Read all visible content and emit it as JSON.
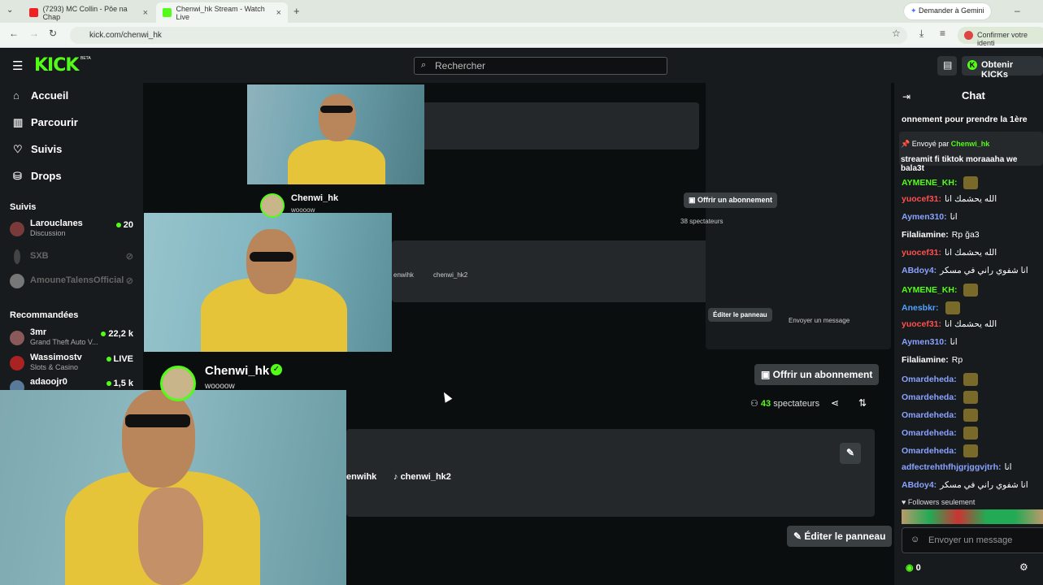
{
  "browser": {
    "tabs": [
      {
        "label": "(7293) MC Collin - Pôe na Chap"
      },
      {
        "label": "Chenwi_hk Stream - Watch Live"
      }
    ],
    "new_tab": "+",
    "gemini": "Demander à Gemini",
    "url": "kick.com/chenwi_hk",
    "confirm": "Confirmer votre identi"
  },
  "topbar": {
    "logo": "KICK",
    "logo_beta": "BETA",
    "search_placeholder": "Rechercher",
    "kicks_button": "Obtenir KICKs"
  },
  "sidebar": {
    "nav": [
      "Accueil",
      "Parcourir",
      "Suivis",
      "Drops"
    ],
    "followed_title": "Suivis",
    "followed": [
      {
        "name": "Larouclanes",
        "category": "Discussion",
        "count": "20",
        "live": true
      },
      {
        "name": "SXB",
        "category": "",
        "count": "",
        "live": false
      },
      {
        "name": "AmouneTalensOfficial",
        "category": "",
        "count": "",
        "live": false
      }
    ],
    "recommended_title": "Recommandées",
    "recommended": [
      {
        "name": "3mr",
        "category": "Grand Theft Auto V...",
        "count": "22,2 k"
      },
      {
        "name": "Wassimostv",
        "category": "Slots & Casino",
        "count": "LIVE"
      },
      {
        "name": "adaoojr0",
        "category": "",
        "count": "1,5 k"
      }
    ]
  },
  "stream": {
    "channel": "Chenwi_hk",
    "subtitle": "woooow",
    "subscribe": "Offrir un abonnement",
    "viewers_count": "43",
    "viewers_label": "spectateurs",
    "link1": "enwihk",
    "link2": "chenwi_hk2",
    "edit_panel": "Éditer le panneau",
    "mid_viewers": "38 spectateurs"
  },
  "chat": {
    "title": "Chat",
    "pinned_top": "onnement pour prendre la 1ère",
    "pinned_by": "Envoyé par",
    "pinned_user": "Chenwi_hk",
    "pinned_msg": "streamit fi tiktok moraaaha we bala3t",
    "messages": [
      {
        "user": "AYMENE_KH:",
        "text": "",
        "color": "#53fc18"
      },
      {
        "user": "yuocef31:",
        "text": "الله يحشمك انا",
        "color": "#ff4f4f"
      },
      {
        "user": "Aymen310:",
        "text": "انا",
        "color": "#8aa2ff"
      },
      {
        "user": "Filaliamine:",
        "text": "Rp ğa3",
        "color": "#ffffff"
      },
      {
        "user": "yuocef31:",
        "text": "الله يحشمك انا",
        "color": "#ff4f4f"
      },
      {
        "user": "ABdoy4:",
        "text": "انا شفوي راني في مسكر",
        "color": "#8aa2ff"
      },
      {
        "user": "AYMENE_KH:",
        "text": "",
        "color": "#53fc18"
      },
      {
        "user": "Anesbkr:",
        "text": "",
        "color": "#4fa3ff"
      },
      {
        "user": "yuocef31:",
        "text": "الله يحشمك انا",
        "color": "#ff4f4f"
      },
      {
        "user": "Aymen310:",
        "text": "انا",
        "color": "#8aa2ff"
      },
      {
        "user": "Filaliamine:",
        "text": "Rp",
        "color": "#ffffff"
      },
      {
        "user": "Omardeheda:",
        "text": "",
        "color": "#8aa2ff"
      },
      {
        "user": "Omardeheda:",
        "text": "",
        "color": "#8aa2ff"
      },
      {
        "user": "Omardeheda:",
        "text": "",
        "color": "#8aa2ff"
      },
      {
        "user": "Omardeheda:",
        "text": "",
        "color": "#8aa2ff"
      },
      {
        "user": "Omardeheda:",
        "text": "",
        "color": "#8aa2ff"
      },
      {
        "user": "adfectrehthfhjgrjggvjtrh:",
        "text": "انا",
        "color": "#8aa2ff"
      },
      {
        "user": "ABdoy4:",
        "text": "انا شفوي راني في مسكر",
        "color": "#8aa2ff"
      }
    ],
    "followers_only": "Followers seulement",
    "input_placeholder": "Envoyer un message",
    "kicks_count": "0"
  }
}
